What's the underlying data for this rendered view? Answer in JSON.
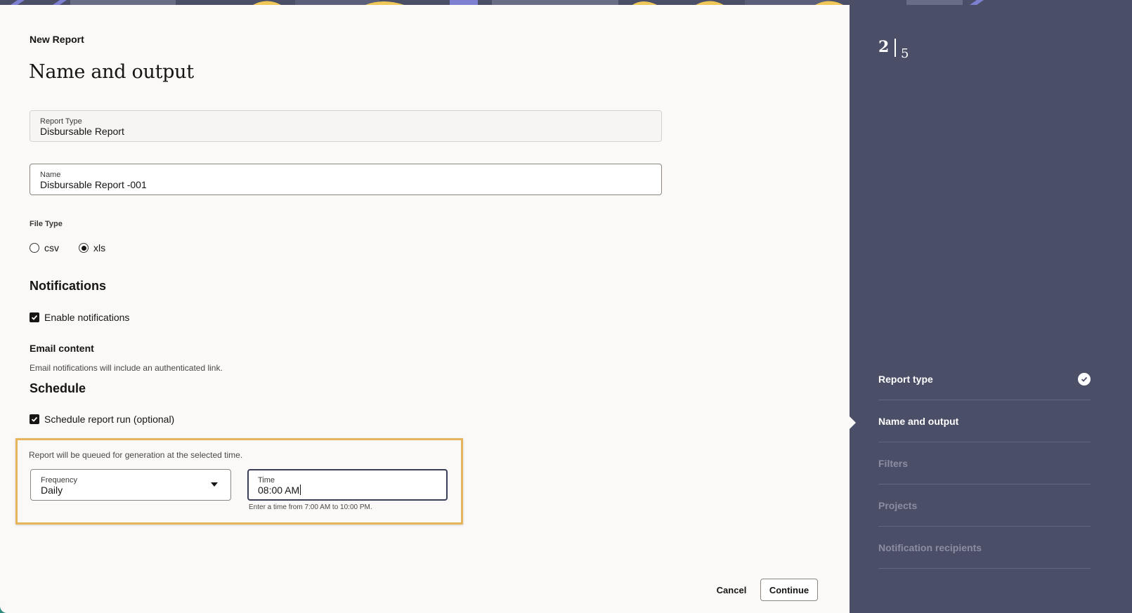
{
  "header": {
    "eyebrow": "New Report",
    "title": "Name and output"
  },
  "form": {
    "report_type": {
      "label": "Report Type",
      "value": "Disbursable Report"
    },
    "name": {
      "label": "Name",
      "value": "Disbursable Report -001"
    },
    "file_type": {
      "label": "File Type",
      "options": [
        {
          "label": "csv",
          "selected": false
        },
        {
          "label": "xls",
          "selected": true
        }
      ]
    }
  },
  "notifications": {
    "heading": "Notifications",
    "enable_label": "Enable notifications",
    "enable_checked": true,
    "email_heading": "Email content",
    "email_helper": "Email notifications will include an authenticated link."
  },
  "schedule": {
    "heading": "Schedule",
    "run_label": "Schedule report run (optional)",
    "run_checked": true,
    "queue_note": "Report will be queued for generation at the selected time.",
    "frequency": {
      "label": "Frequency",
      "value": "Daily"
    },
    "time": {
      "label": "Time",
      "value": "08:00 AM",
      "hint": "Enter a time from 7:00 AM to 10:00 PM."
    }
  },
  "footer": {
    "cancel_label": "Cancel",
    "continue_label": "Continue"
  },
  "progress": {
    "current": "2",
    "total": "5",
    "steps": [
      {
        "label": "Report type",
        "state": "done"
      },
      {
        "label": "Name and output",
        "state": "current"
      },
      {
        "label": "Filters",
        "state": "pending"
      },
      {
        "label": "Projects",
        "state": "pending"
      },
      {
        "label": "Notification recipients",
        "state": "pending"
      }
    ]
  },
  "colors": {
    "sidebar_bg": "#4b4e67",
    "highlight_border": "#e6b45a",
    "main_bg": "#fbf9f8"
  }
}
